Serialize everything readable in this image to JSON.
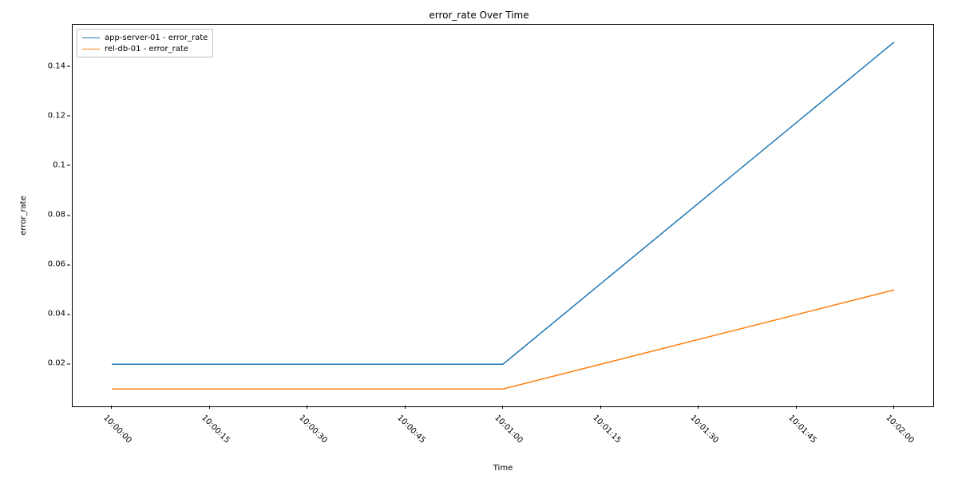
{
  "chart_data": {
    "type": "line",
    "title": "error_rate Over Time",
    "xlabel": "Time",
    "ylabel": "error_rate",
    "x": [
      "10:00:00",
      "10:01:00",
      "10:02:00"
    ],
    "series": [
      {
        "name": "app-server-01 - error_rate",
        "color": "#1f77b4",
        "values": [
          0.02,
          0.02,
          0.15
        ]
      },
      {
        "name": "rel-db-01 - error_rate",
        "color": "#ff7f0e",
        "values": [
          0.01,
          0.01,
          0.05
        ]
      }
    ],
    "x_ticks": [
      "10:00:00",
      "10:00:15",
      "10:00:30",
      "10:00:45",
      "10:01:00",
      "10:01:15",
      "10:01:30",
      "10:01:45",
      "10:02:00"
    ],
    "y_ticks": [
      0.02,
      0.04,
      0.06,
      0.08,
      0.1,
      0.12,
      0.14
    ],
    "xlim_seconds": [
      -6,
      126
    ],
    "ylim": [
      0.003,
      0.157
    ],
    "legend_loc": "upper-left"
  }
}
